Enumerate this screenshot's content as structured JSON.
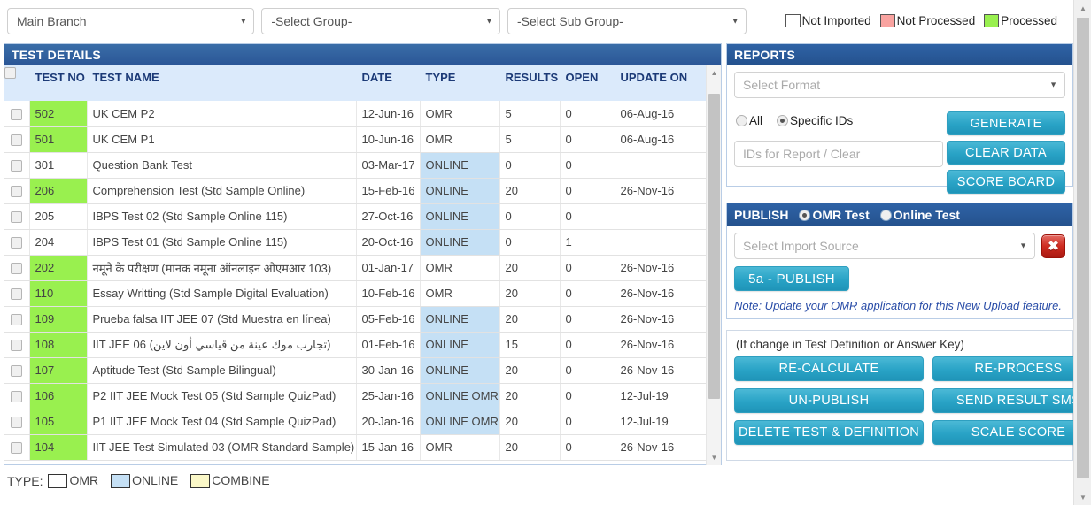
{
  "topbar": {
    "branch_select": {
      "value": "Main Branch",
      "caret": "chevron-down-icon"
    },
    "group_select": {
      "value": "-Select Group-"
    },
    "subgroup_select": {
      "value": "-Select Sub Group-"
    },
    "legend": [
      {
        "label": "Not Imported",
        "color": "#ffffff"
      },
      {
        "label": "Not Processed",
        "color": "#f9a3a0"
      },
      {
        "label": "Processed",
        "color": "#99f04f"
      }
    ]
  },
  "test_details": {
    "title": "TEST DETAILS",
    "columns": {
      "test_no": "TEST NO",
      "test_name": "TEST NAME",
      "date": "DATE",
      "type": "TYPE",
      "results": "RESULTS",
      "open": "OPEN",
      "update_on": "UPDATE ON"
    },
    "rows": [
      {
        "no": "502",
        "name": "UK CEM P2",
        "date": "12-Jun-16",
        "type": "OMR",
        "results": "5",
        "open": "0",
        "update_on": "06-Aug-16",
        "status": "processed",
        "type_class": "omr"
      },
      {
        "no": "501",
        "name": "UK CEM P1",
        "date": "10-Jun-16",
        "type": "OMR",
        "results": "5",
        "open": "0",
        "update_on": "06-Aug-16",
        "status": "processed",
        "type_class": "omr"
      },
      {
        "no": "301",
        "name": "Question Bank Test",
        "date": "03-Mar-17",
        "type": "ONLINE",
        "results": "0",
        "open": "0",
        "update_on": "",
        "status": "none",
        "type_class": "online"
      },
      {
        "no": "206",
        "name": "Comprehension Test (Std Sample Online)",
        "date": "15-Feb-16",
        "type": "ONLINE",
        "results": "20",
        "open": "0",
        "update_on": "26-Nov-16",
        "status": "processed",
        "type_class": "online"
      },
      {
        "no": "205",
        "name": "IBPS Test 02 (Std Sample Online 115)",
        "date": "27-Oct-16",
        "type": "ONLINE",
        "results": "0",
        "open": "0",
        "update_on": "",
        "status": "none",
        "type_class": "online"
      },
      {
        "no": "204",
        "name": "IBPS Test 01 (Std Sample Online 115)",
        "date": "20-Oct-16",
        "type": "ONLINE",
        "results": "0",
        "open": "1",
        "update_on": "",
        "status": "none",
        "type_class": "online"
      },
      {
        "no": "202",
        "name": "नमूने के परीक्षण (मानक नमूना ऑनलाइन ओएमआर 103)",
        "date": "01-Jan-17",
        "type": "OMR",
        "results": "20",
        "open": "0",
        "update_on": "26-Nov-16",
        "status": "processed",
        "type_class": "omr"
      },
      {
        "no": "110",
        "name": "Essay Writting (Std Sample Digital Evaluation)",
        "date": "10-Feb-16",
        "type": "OMR",
        "results": "20",
        "open": "0",
        "update_on": "26-Nov-16",
        "status": "processed",
        "type_class": "omr"
      },
      {
        "no": "109",
        "name": "Prueba falsa IIT JEE 07 (Std Muestra en línea)",
        "date": "05-Feb-16",
        "type": "ONLINE",
        "results": "20",
        "open": "0",
        "update_on": "26-Nov-16",
        "status": "processed",
        "type_class": "online"
      },
      {
        "no": "108",
        "name": "IIT JEE 06 (تجارب موك عينة من قياسي أون لاين)",
        "date": "01-Feb-16",
        "type": "ONLINE",
        "results": "15",
        "open": "0",
        "update_on": "26-Nov-16",
        "status": "processed",
        "type_class": "online"
      },
      {
        "no": "107",
        "name": "Aptitude Test (Std Sample Bilingual)",
        "date": "30-Jan-16",
        "type": "ONLINE",
        "results": "20",
        "open": "0",
        "update_on": "26-Nov-16",
        "status": "processed",
        "type_class": "online"
      },
      {
        "no": "106",
        "name": "P2 IIT JEE Mock Test 05 (Std Sample QuizPad)",
        "date": "25-Jan-16",
        "type": "ONLINE OMR",
        "results": "20",
        "open": "0",
        "update_on": "12-Jul-19",
        "status": "processed",
        "type_class": "online"
      },
      {
        "no": "105",
        "name": "P1 IIT JEE Mock Test 04 (Std Sample QuizPad)",
        "date": "20-Jan-16",
        "type": "ONLINE OMR",
        "results": "20",
        "open": "0",
        "update_on": "12-Jul-19",
        "status": "processed",
        "type_class": "online"
      },
      {
        "no": "104",
        "name": "IIT JEE Test Simulated 03 (OMR Standard Sample)",
        "date": "15-Jan-16",
        "type": "OMR",
        "results": "20",
        "open": "0",
        "update_on": "26-Nov-16",
        "status": "processed",
        "type_class": "omr"
      }
    ]
  },
  "reports": {
    "title": "REPORTS",
    "format_placeholder": "Select Format",
    "radio_all": "All",
    "radio_specific": "Specific IDs",
    "selected_radio": "Specific IDs",
    "ids_placeholder": "IDs for Report / Clear",
    "ids_value": "",
    "generate": "GENERATE",
    "clear_data": "CLEAR DATA",
    "score_board": "SCORE BOARD"
  },
  "publish": {
    "title": "PUBLISH",
    "radio_omr": "OMR Test",
    "radio_online": "Online Test",
    "selected_radio": "OMR Test",
    "import_source_placeholder": "Select Import Source",
    "clear_icon": "close-icon",
    "publish_button": "5a - PUBLISH",
    "note": "Note: Update your OMR application for this New Upload feature."
  },
  "actions": {
    "note": "(If change in Test Definition or Answer Key)",
    "buttons": [
      "RE-CALCULATE",
      "RE-PROCESS",
      "UN-PUBLISH",
      "SEND RESULT SMS",
      "DELETE TEST & DEFINITION",
      "SCALE SCORE"
    ]
  },
  "bottom_legend": {
    "label": "TYPE:",
    "items": [
      {
        "label": "OMR",
        "color": "#ffffff"
      },
      {
        "label": "ONLINE",
        "color": "#c5e0f5"
      },
      {
        "label": "COMBINE",
        "color": "#fbf8c8"
      }
    ]
  }
}
